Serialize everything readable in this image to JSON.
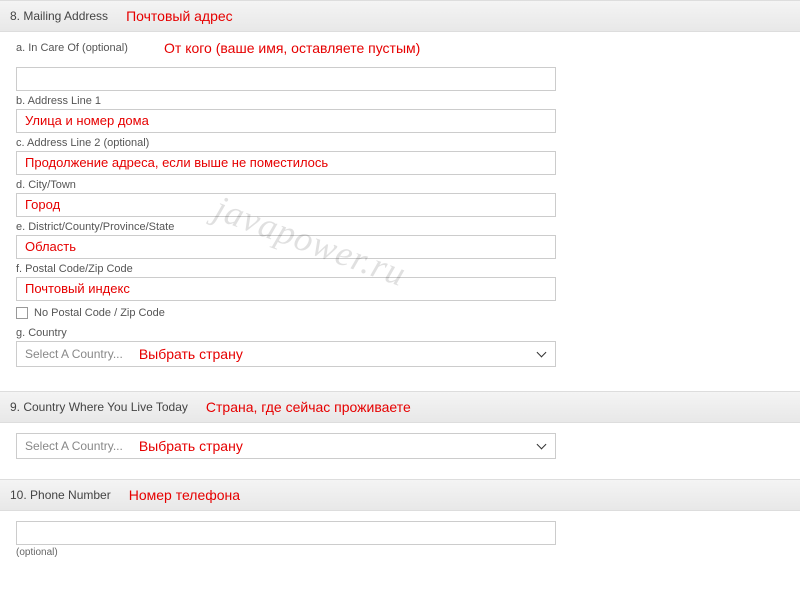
{
  "watermark": "javapower.ru",
  "sections": {
    "mailing": {
      "title": "8. Mailing Address",
      "annotation": "Почтовый адрес",
      "fields": {
        "careOf": {
          "label": "a. In Care Of (optional)",
          "annotation": "От кого (ваше имя, оставляете пустым)",
          "value": ""
        },
        "addr1": {
          "label": "b. Address Line 1",
          "value": "Улица и номер дома"
        },
        "addr2": {
          "label": "c. Address Line 2 (optional)",
          "value": "Продолжение адреса, если выше не поместилось"
        },
        "city": {
          "label": "d. City/Town",
          "value": "Город"
        },
        "district": {
          "label": "e. District/County/Province/State",
          "value": "Область"
        },
        "postal": {
          "label": "f. Postal Code/Zip Code",
          "value": "Почтовый индекс"
        },
        "noPostal": {
          "label": "No Postal Code / Zip Code"
        },
        "country": {
          "label": "g. Country",
          "placeholder": "Select A Country...",
          "annotation": "Выбрать страну"
        }
      }
    },
    "countryLive": {
      "title": "9. Country Where You Live Today",
      "annotation": "Страна, где сейчас проживаете",
      "select": {
        "placeholder": "Select A Country...",
        "annotation": "Выбрать страну"
      }
    },
    "phone": {
      "title": "10. Phone Number",
      "annotation": "Номер телефона",
      "value": "",
      "optional": "(optional)"
    }
  }
}
